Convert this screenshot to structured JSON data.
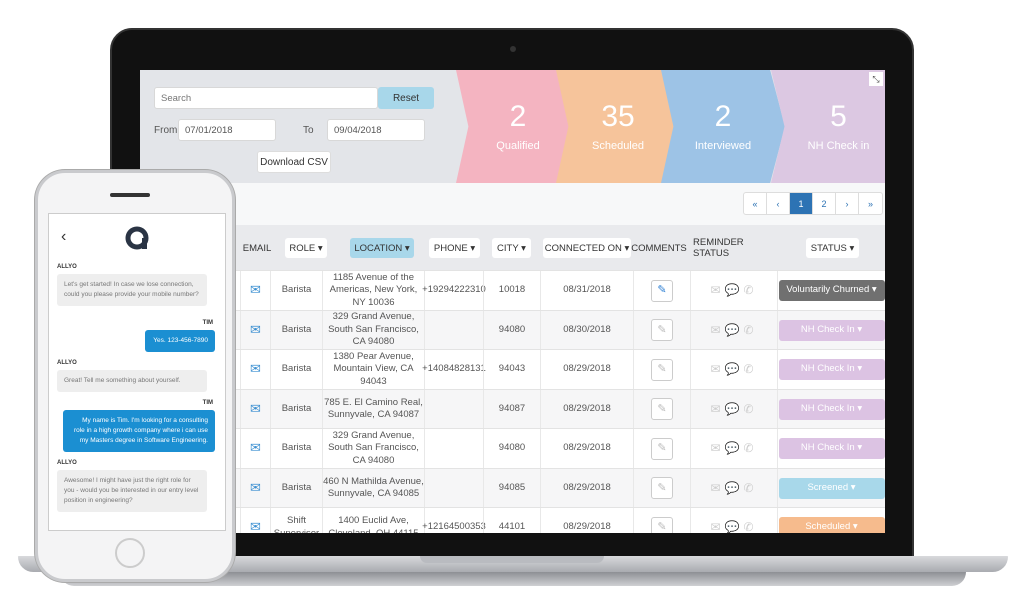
{
  "filters": {
    "search_placeholder": "Search",
    "reset": "Reset",
    "from_label": "From",
    "from_value": "07/01/2018",
    "to_label": "To",
    "to_value": "09/04/2018",
    "download": "Download CSV"
  },
  "funnel": [
    {
      "count": "2",
      "label": "Qualified",
      "color": "#f4b4c1"
    },
    {
      "count": "35",
      "label": "Scheduled",
      "color": "#f6c49b"
    },
    {
      "count": "2",
      "label": "Interviewed",
      "color": "#9dc3e6"
    },
    {
      "count": "5",
      "label": "NH Check in",
      "color": "#dcc8e2"
    }
  ],
  "pagination": {
    "first": "«",
    "prev": "‹",
    "pages": [
      "1",
      "2"
    ],
    "current": "1",
    "next": "›",
    "last": "»"
  },
  "columns": {
    "email": "EMAIL",
    "role": "ROLE ▾",
    "location": "LOCATION ▾",
    "phone": "PHONE ▾",
    "city": "CITY ▾",
    "connected": "CONNECTED ON ▾",
    "comments": "COMMENTS",
    "reminder": "REMINDER STATUS",
    "status": "STATUS ▾"
  },
  "rows": [
    {
      "role": "Barista",
      "location": "1185 Avenue of the Americas, New York, NY 10036",
      "phone": "+19294222310",
      "city": "10018",
      "connected": "08/31/2018",
      "status": "Voluntarily Churned ▾",
      "status_color": "#707070",
      "comment_active": true
    },
    {
      "role": "Barista",
      "location": "329 Grand Avenue, South San Francisco, CA 94080",
      "phone": "",
      "city": "94080",
      "connected": "08/30/2018",
      "status": "NH Check In ▾",
      "status_color": "#dcc3e3"
    },
    {
      "role": "Barista",
      "location": "1380 Pear Avenue, Mountain View, CA 94043",
      "phone": "+14084828131",
      "city": "94043",
      "connected": "08/29/2018",
      "status": "NH Check In ▾",
      "status_color": "#dcc3e3"
    },
    {
      "role": "Barista",
      "location": "785 E. El Camino Real, Sunnyvale, CA 94087",
      "phone": "",
      "city": "94087",
      "connected": "08/29/2018",
      "status": "NH Check In ▾",
      "status_color": "#dcc3e3"
    },
    {
      "role": "Barista",
      "location": "329 Grand Avenue, South San Francisco, CA 94080",
      "phone": "",
      "city": "94080",
      "connected": "08/29/2018",
      "status": "NH Check In ▾",
      "status_color": "#dcc3e3"
    },
    {
      "role": "Barista",
      "location": "460 N Mathilda Avenue, Sunnyvale, CA 94085",
      "phone": "",
      "city": "94085",
      "connected": "08/29/2018",
      "status": "Screened ▾",
      "status_color": "#a8d8ea"
    },
    {
      "role": "Shift Supervisor",
      "location": "1400 Euclid Ave, Cleveland, OH 44115",
      "phone": "+12164500353",
      "city": "44101",
      "connected": "08/29/2018",
      "status": "Scheduled ▾",
      "status_color": "#f6bb8d"
    }
  ],
  "chat": {
    "back": "‹",
    "messages": [
      {
        "from": "ALLYO",
        "text": "Let's get started! In case we lose connection, could you please provide your mobile number?"
      },
      {
        "from": "TIM",
        "text": "Yes. 123-456-7890"
      },
      {
        "from": "ALLYO",
        "text": "Great! Tell me something about yourself."
      },
      {
        "from": "TIM",
        "text": "My name is Tim. I'm looking for a consulting role in a high growth company where i can use my Masters degree in Software Engineering."
      },
      {
        "from": "ALLYO",
        "text": "Awesome! I might have just the right role for you - would you be interested in our entry level position in engineering?"
      }
    ]
  }
}
